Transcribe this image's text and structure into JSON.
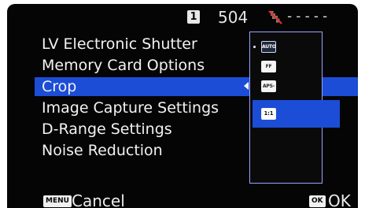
{
  "status": {
    "card_slot": "1",
    "shots_remaining": "504",
    "gps_status": "-----"
  },
  "menu": {
    "items": [
      {
        "label": "LV Electronic Shutter"
      },
      {
        "label": "Memory Card Options"
      },
      {
        "label": "Crop",
        "selected": true
      },
      {
        "label": "Image Capture Settings"
      },
      {
        "label": "D-Range Settings"
      },
      {
        "label": "Noise Reduction"
      }
    ]
  },
  "crop_options": {
    "items": [
      {
        "label": "AUTO",
        "icon": "crop-auto-icon"
      },
      {
        "label": "FF",
        "icon": "crop-ff-icon"
      },
      {
        "label": "APS-C",
        "icon": "crop-apsc-icon"
      },
      {
        "label": "1:1",
        "icon": "crop-1-1-icon"
      }
    ],
    "selected_index": 3
  },
  "footer": {
    "cancel_key": "MENU",
    "cancel_label": "Cancel",
    "ok_key": "OK",
    "ok_label": "OK"
  },
  "colors": {
    "background": "#050505",
    "highlight": "#1b4dd6",
    "panel_border": "#9aa3ff",
    "text": "#f2f2f2"
  }
}
